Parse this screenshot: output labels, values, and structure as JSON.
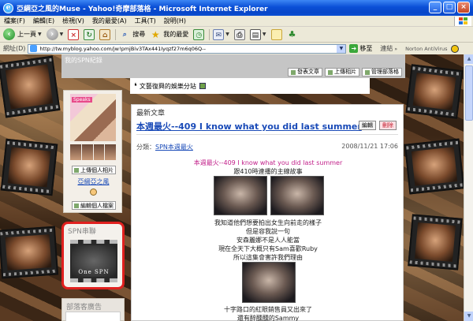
{
  "window": {
    "title": "亞綱亞之風的Muse - Yahoo!奇摩部落格 - Microsoft Internet Explorer",
    "buttons": {
      "minimize": "_",
      "maximize": "□",
      "close": "×"
    }
  },
  "menu": [
    "檔案(F)",
    "編輯(E)",
    "檢視(V)",
    "我的最愛(A)",
    "工具(T)",
    "說明(H)"
  ],
  "toolbar": {
    "back_label": "上一頁",
    "search_label": "搜尋",
    "favorites_label": "我的最愛"
  },
  "address": {
    "label": "網址(D)",
    "url": "http://tw.myblog.yahoo.com/jw!pmjBiv3TAx441Iyqzf27m6q06Q--",
    "go_label": "移至",
    "links_label": "連結",
    "norton_label": "Norton AntiVirus"
  },
  "page": {
    "top_caption": "我的SPN紀錄",
    "top_buttons": [
      "發表文章",
      "上傳相片",
      "管理部落格"
    ],
    "blog_title": "文藝復興的娛樂分站",
    "profile": {
      "photo_tag": "Speaks",
      "upload_photo": "上傳個人相片",
      "name": "亞綱亞之風",
      "edit_profile": "編輯個人檔案"
    },
    "spn_widget": {
      "header": "SPN串聯",
      "image_text": "One SPN"
    },
    "ad_header": "部落客廣告",
    "post": {
      "section": "最新文章",
      "title": "本週最火--409 I know what you did last summer",
      "edit": "編輯",
      "delete": "刪除",
      "category_label": "分類：",
      "category": "SPN本週最火",
      "date": "2008/11/21 17:06",
      "lines": [
        "本週最火--409 I know what you did last summer",
        "跟410時連播的主線故事",
        "我知道他們想要拍出女生向前走的樣子",
        "但是容我說一句",
        "安森麗娜不是人人能當",
        "現在全天下大概只有Sam喜歡Ruby",
        "所以這集會害許我們理由",
        "十字路口的紅眼銷售員又出來了",
        "還有醉醺醺的Sammy"
      ]
    }
  }
}
